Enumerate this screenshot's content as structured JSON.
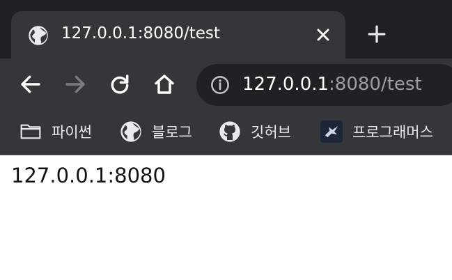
{
  "tab": {
    "title": "127.0.0.1:8080/test"
  },
  "omnibox": {
    "host": "127.0.0.1",
    "rest": ":8080/test"
  },
  "bookmarks": [
    {
      "label": "파이썬",
      "icon": "folder-icon"
    },
    {
      "label": "블로그",
      "icon": "globe-icon"
    },
    {
      "label": "깃허브",
      "icon": "github-icon"
    },
    {
      "label": "프로그래머스",
      "icon": "programmers-icon"
    }
  ],
  "page": {
    "text": "127.0.0.1:8080"
  },
  "colors": {
    "tabstrip": "#202124",
    "toolbar": "#35363a",
    "omnibox": "#202124",
    "url_dim": "#9aa0a6"
  }
}
